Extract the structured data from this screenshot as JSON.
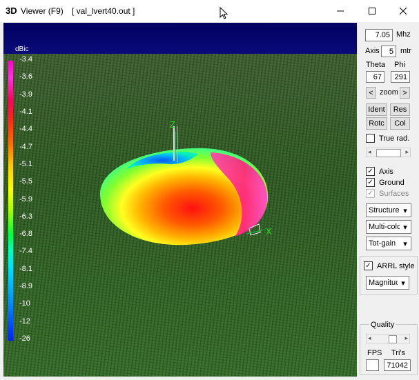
{
  "window": {
    "app_icon": "3D",
    "title": "Viewer (F9)",
    "file": "[  val_lvert40.out ]"
  },
  "scale": {
    "unit": "dBic",
    "ticks": [
      "-3.4",
      "-3.6",
      "-3.9",
      "-4.1",
      "-4.4",
      "-4.7",
      "-5.1",
      "-5.5",
      "-5.9",
      "-6.3",
      "-6.8",
      "-7.4",
      "-8.1",
      "-8.9",
      "-10",
      "-12",
      "-26"
    ]
  },
  "axes": {
    "z": "Z",
    "x": "X"
  },
  "panel": {
    "freq_value": "7.05",
    "freq_unit": "Mhz",
    "axis_label": "Axis",
    "axis_value": "5",
    "axis_unit": "mtr",
    "theta_label": "Theta",
    "phi_label": "Phi",
    "theta_value": "67",
    "phi_value": "291",
    "zoom_label": "zoom",
    "zoom_left": "<",
    "zoom_right": ">",
    "ident": "Ident",
    "res": "Res",
    "rotc": "Rotc",
    "col": "Col",
    "true_rad": "True rad.",
    "axis_chk": "Axis",
    "ground_chk": "Ground",
    "surfaces_chk": "Surfaces",
    "structure": "Structure",
    "multicolor": "Multi-colo",
    "totgain": "Tot-gain",
    "arrl": "ARRL style",
    "magnitude": "Magnituc",
    "quality": "Quality",
    "fps": "FPS",
    "tris": "Tri's",
    "fps_value": "",
    "tris_value": "71042"
  },
  "states": {
    "true_rad": false,
    "axis": true,
    "ground": true,
    "surfaces": true,
    "arrl": true
  },
  "icons": [
    "app-3d-icon",
    "minimize-icon",
    "maximize-icon",
    "close-icon",
    "cursor-icon",
    "dropdown-arrow-icon",
    "check-icon"
  ]
}
